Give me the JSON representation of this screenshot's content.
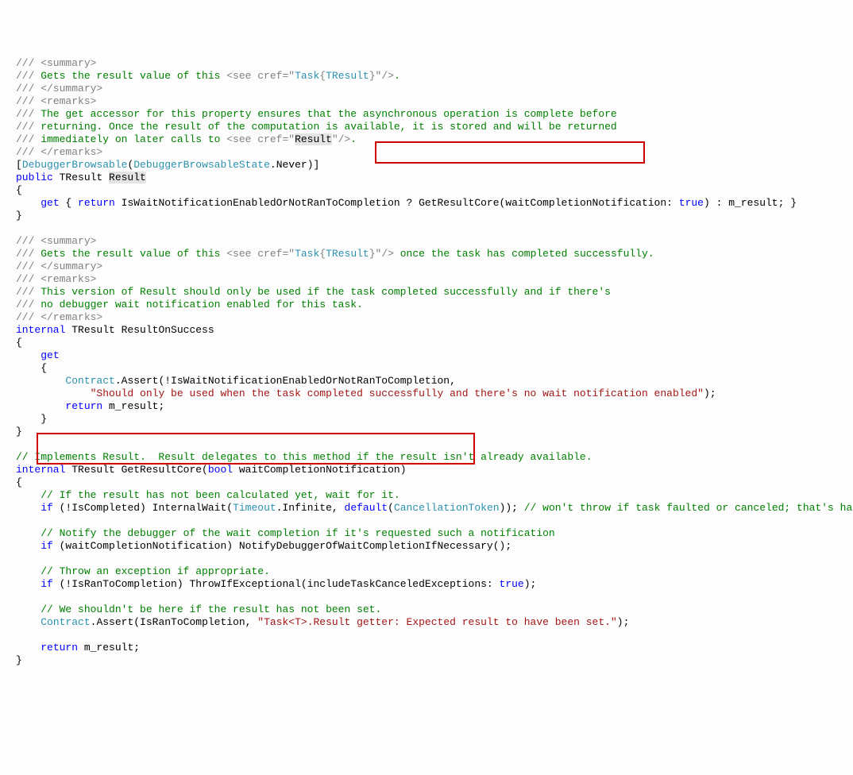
{
  "l1": "///",
  "l1b": " <summary>",
  "l2": "///",
  "l2b": " Gets the result value of this ",
  "l2c": "<see cref=\"",
  "l2d": "Task",
  "l2e": "{",
  "l2f": "TResult",
  "l2g": "}\"/>",
  "l2h": ".",
  "l3": "///",
  "l3b": " </summary>",
  "l4": "///",
  "l4b": " <remarks>",
  "l5": "///",
  "l5b": " The get accessor for this property ensures that the asynchronous operation is complete before",
  "l6": "///",
  "l6b": " returning. Once the result of the computation is available, it is stored and will be returned",
  "l7": "///",
  "l7b": " immediately on later calls to ",
  "l7c": "<see cref=\"",
  "l7d": "Result",
  "l7e": "\"/>",
  "l7f": ".",
  "l8": "///",
  "l8b": " </remarks>",
  "l9a": "[",
  "l9b": "DebuggerBrowsable",
  "l9c": "(",
  "l9d": "DebuggerBrowsableState",
  "l9e": ".Never)]",
  "l10a": "public",
  "l10b": " TResult ",
  "l10c": "Result",
  "l11a": "{",
  "l12a": "    ",
  "l12b": "get",
  "l12c": " { ",
  "l12d": "return",
  "l12e": " IsWaitNotificationEnabledOrNotRanToCompletion ? GetResultCore(waitCompletionNotification: ",
  "l12f": "true",
  "l12g": ") : m_result; }",
  "l13a": "}",
  "l15": "///",
  "l15b": " <summary>",
  "l16": "///",
  "l16b": " Gets the result value of this ",
  "l16c": "<see cref=\"",
  "l16d": "Task",
  "l16e": "{",
  "l16f": "TResult",
  "l16g": "}\"/>",
  "l16h": " once the task has completed successfully.",
  "l17": "///",
  "l17b": " </summary>",
  "l18": "///",
  "l18b": " <remarks>",
  "l19": "///",
  "l19b": " This version of Result should only be used if the task completed successfully and if there's",
  "l20": "///",
  "l20b": " no debugger wait notification enabled for this task.",
  "l21": "///",
  "l21b": " </remarks>",
  "l22a": "internal",
  "l22b": " TResult ResultOnSuccess",
  "l23a": "{",
  "l24a": "    ",
  "l24b": "get",
  "l25a": "    {",
  "l26a": "        ",
  "l26b": "Contract",
  "l26c": ".Assert(!IsWaitNotificationEnabledOrNotRanToCompletion,",
  "l27a": "            ",
  "l27b": "\"Should only be used when the task completed successfully and there's no wait notification enabled\"",
  "l27c": ");",
  "l28a": "        ",
  "l28b": "return",
  "l28c": " m_result;",
  "l29a": "    }",
  "l30a": "}",
  "l32": "// Implements Result.  Result delegates to this method if the result isn't already available.",
  "l33a": "internal",
  "l33b": " TResult GetResultCore(",
  "l33c": "bool",
  "l33d": " waitCompletionNotification)",
  "l34a": "{",
  "l35a": "    ",
  "l35b": "// If the result has not been calculated yet, wait for it.",
  "l36a": "    ",
  "l36b": "if",
  "l36c": " (!IsCompleted) InternalWait(",
  "l36d": "Timeout",
  "l36e": ".Infinite, ",
  "l36f": "default",
  "l36g": "(",
  "l36h": "CancellationToken",
  "l36i": ")); ",
  "l36j": "// won't throw if task faulted or canceled; that's handled below",
  "l38a": "    ",
  "l38b": "// Notify the debugger of the wait completion if it's requested such a notification",
  "l39a": "    ",
  "l39b": "if",
  "l39c": " (waitCompletionNotification) NotifyDebuggerOfWaitCompletionIfNecessary();",
  "l41a": "    ",
  "l41b": "// Throw an exception if appropriate.",
  "l42a": "    ",
  "l42b": "if",
  "l42c": " (!IsRanToCompletion) ThrowIfExceptional(includeTaskCanceledExceptions: ",
  "l42d": "true",
  "l42e": ");",
  "l44a": "    ",
  "l44b": "// We shouldn't be here if the result has not been set.",
  "l45a": "    ",
  "l45b": "Contract",
  "l45c": ".Assert(IsRanToCompletion, ",
  "l45d": "\"Task<T>.Result getter: Expected result to have been set.\"",
  "l45e": ");",
  "l47a": "    ",
  "l47b": "return",
  "l47c": " m_result;",
  "l48a": "}"
}
